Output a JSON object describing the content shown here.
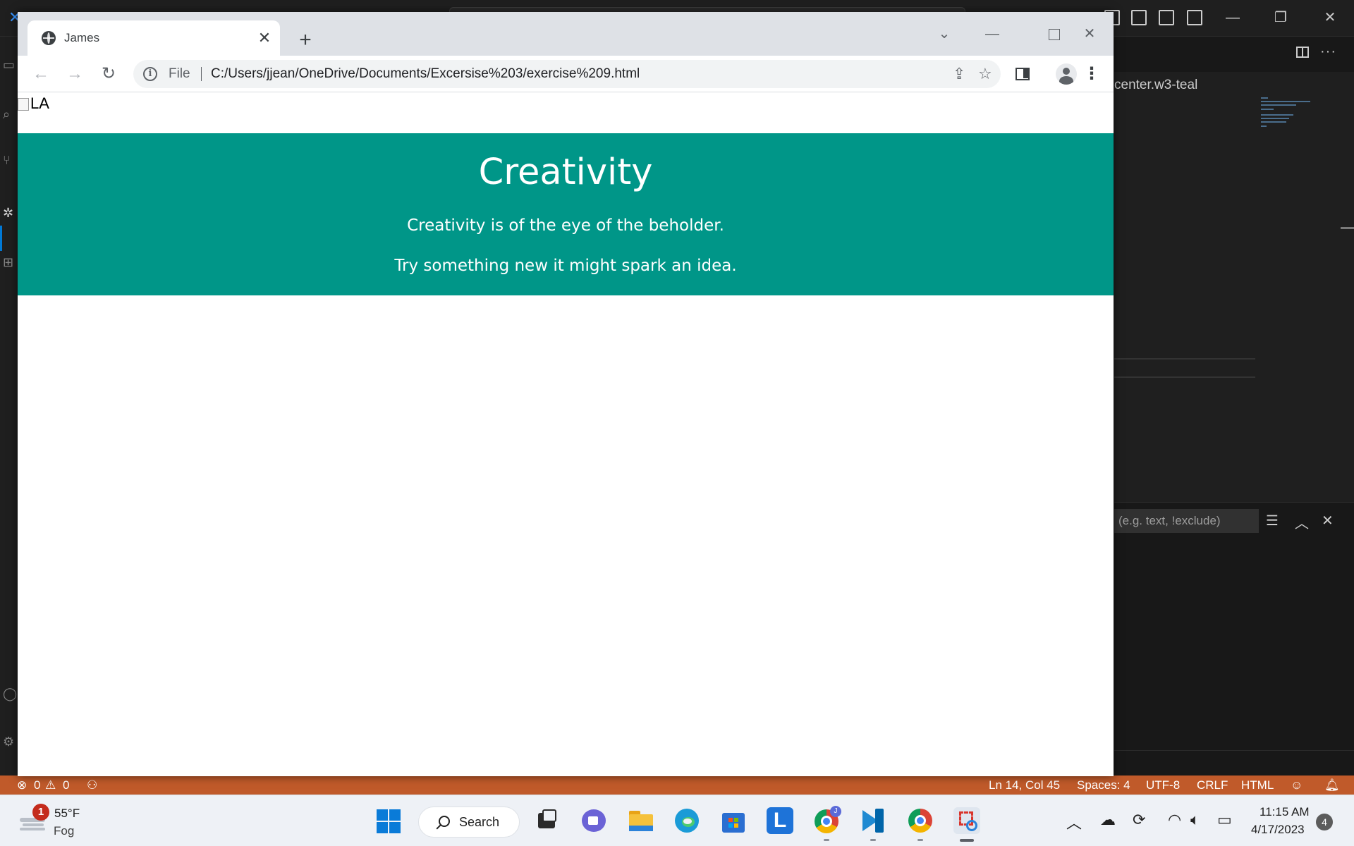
{
  "browser": {
    "tab_title": "James",
    "tab_close_glyph": "✕",
    "new_tab_glyph": "+",
    "url_scheme_label": "File",
    "url": "C:/Users/jjean/OneDrive/Documents/Excersise%203/exercise%209.html",
    "icons": [
      "globe-icon",
      "back-arrow-icon",
      "forward-arrow-icon",
      "reload-icon",
      "info-icon",
      "share-icon",
      "star-icon",
      "side-panel-icon",
      "profile-icon",
      "menu-icon",
      "chevron-down-icon",
      "minimize-icon",
      "maximize-icon",
      "close-icon"
    ]
  },
  "page": {
    "broken_image_alt": "LA",
    "header": {
      "title": "Creativity",
      "line1": "Creativity is of the eye of the beholder.",
      "line2": "Try something new it might spark an idea.",
      "background_color": "#009688"
    }
  },
  "vscode": {
    "editor_snippet": "center.w3-teal",
    "filter_placeholder": "(e.g. text, !exclude)",
    "status": {
      "errors": "0",
      "warnings": "0",
      "position": "Ln 14, Col 45",
      "spaces": "Spaces: 4",
      "encoding": "UTF-8",
      "eol": "CRLF",
      "language": "HTML",
      "background_color": "#c05a2a"
    }
  },
  "taskbar": {
    "weather_temp": "55°F",
    "weather_condition": "Fog",
    "weather_badge": "1",
    "search_label": "Search",
    "time": "11:15 AM",
    "date": "4/17/2023",
    "notification_count": "4"
  }
}
